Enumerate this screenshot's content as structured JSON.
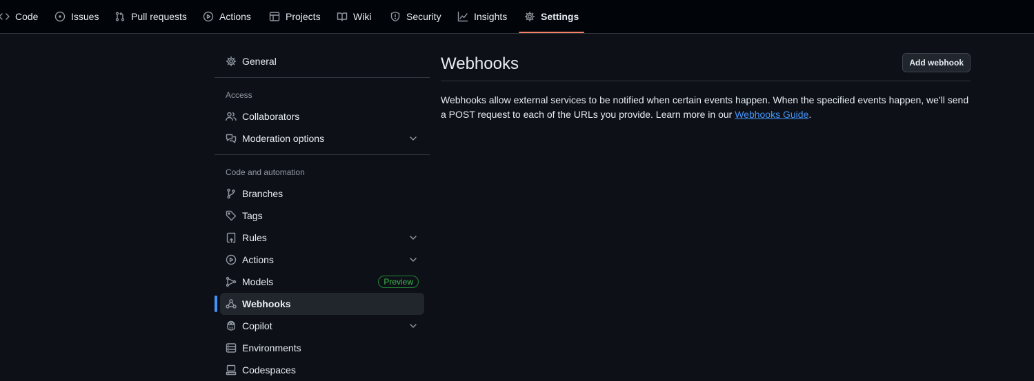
{
  "repo_nav": {
    "tabs": [
      {
        "label": "Code",
        "icon": "code-icon"
      },
      {
        "label": "Issues",
        "icon": "issue-opened-icon"
      },
      {
        "label": "Pull requests",
        "icon": "git-pull-request-icon"
      },
      {
        "label": "Actions",
        "icon": "play-icon"
      },
      {
        "label": "Projects",
        "icon": "table-icon"
      },
      {
        "label": "Wiki",
        "icon": "book-icon"
      },
      {
        "label": "Security",
        "icon": "shield-icon"
      },
      {
        "label": "Insights",
        "icon": "graph-icon"
      },
      {
        "label": "Settings",
        "icon": "gear-icon",
        "active": true
      }
    ]
  },
  "sidebar": {
    "general": {
      "label": "General",
      "icon": "gear-icon"
    },
    "access_heading": "Access",
    "access_items": [
      {
        "label": "Collaborators",
        "icon": "people-icon"
      },
      {
        "label": "Moderation options",
        "icon": "comment-discussion-icon",
        "expandable": true
      }
    ],
    "automation_heading": "Code and automation",
    "automation_items": [
      {
        "label": "Branches",
        "icon": "git-branch-icon"
      },
      {
        "label": "Tags",
        "icon": "tag-icon"
      },
      {
        "label": "Rules",
        "icon": "repo-push-icon",
        "expandable": true
      },
      {
        "label": "Actions",
        "icon": "play-icon",
        "expandable": true
      },
      {
        "label": "Models",
        "icon": "models-icon",
        "badge": "Preview"
      },
      {
        "label": "Webhooks",
        "icon": "webhook-icon",
        "current": true
      },
      {
        "label": "Copilot",
        "icon": "copilot-icon",
        "expandable": true
      },
      {
        "label": "Environments",
        "icon": "server-icon"
      },
      {
        "label": "Codespaces",
        "icon": "codespaces-icon"
      }
    ]
  },
  "main": {
    "title": "Webhooks",
    "add_button": "Add webhook",
    "description": "Webhooks allow external services to be notified when certain events happen. When the specified events happen, we'll send a POST request to each of the URLs you provide. Learn more in our ",
    "link_text": "Webhooks Guide",
    "description_end": "."
  },
  "colors": {
    "background": "#0d1117",
    "header_background": "#010409",
    "active_tab_underline": "#f78166",
    "link": "#4493f8",
    "current_item_bar": "#4493f8",
    "preview_badge": "#3fb950"
  }
}
